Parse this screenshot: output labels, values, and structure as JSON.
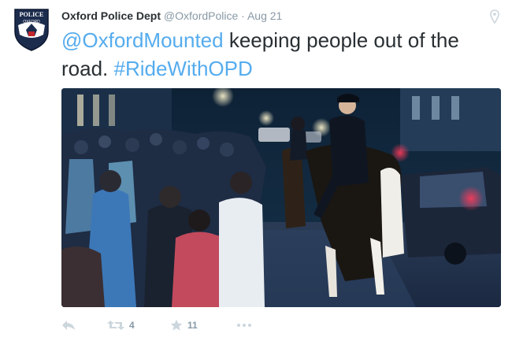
{
  "tweet": {
    "display_name": "Oxford Police Dept",
    "handle": "@OxfordPolice",
    "separator": "·",
    "date": "Aug 21",
    "text_mention": "@OxfordMounted",
    "text_middle": " keeping people out of the road. ",
    "text_hashtag": "#RideWithOPD",
    "avatar_badge_top": "POLICE",
    "avatar_badge_mid": "OXFORD",
    "photo_icon": "photo-image",
    "colors": {
      "link": "#55acee",
      "name": "#292f33",
      "meta": "#8899a6"
    }
  },
  "actions": {
    "reply_icon": "reply-icon",
    "retweet_icon": "retweet-icon",
    "retweet_count": "4",
    "favorite_icon": "star-icon",
    "favorite_count": "11",
    "more_icon": "more-icon"
  }
}
